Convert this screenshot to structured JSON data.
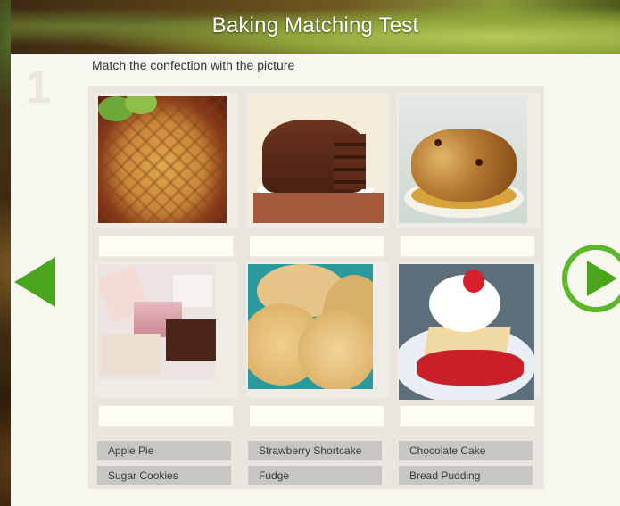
{
  "header": {
    "title": "Baking Matching Test"
  },
  "question": {
    "number": "1",
    "instruction": "Match the confection with the picture"
  },
  "pictures": [
    {
      "icon": "apple-pie-photo",
      "answer": ""
    },
    {
      "icon": "chocolate-cake-photo",
      "answer": ""
    },
    {
      "icon": "bread-pudding-photo",
      "answer": ""
    },
    {
      "icon": "fudge-photo",
      "answer": ""
    },
    {
      "icon": "sugar-cookies-photo",
      "answer": ""
    },
    {
      "icon": "strawberry-shortcake-photo",
      "answer": ""
    }
  ],
  "answer_bank": [
    "Apple Pie",
    "Strawberry Shortcake",
    "Chocolate Cake",
    "Sugar Cookies",
    "Fudge",
    "Bread Pudding"
  ],
  "nav": {
    "prev_icon": "arrow-left-icon",
    "next_icon": "play-next-icon"
  },
  "colors": {
    "accent_green": "#4aa61c",
    "card_bg": "#f7f6ef",
    "chip_bg": "#c8c6c0"
  }
}
